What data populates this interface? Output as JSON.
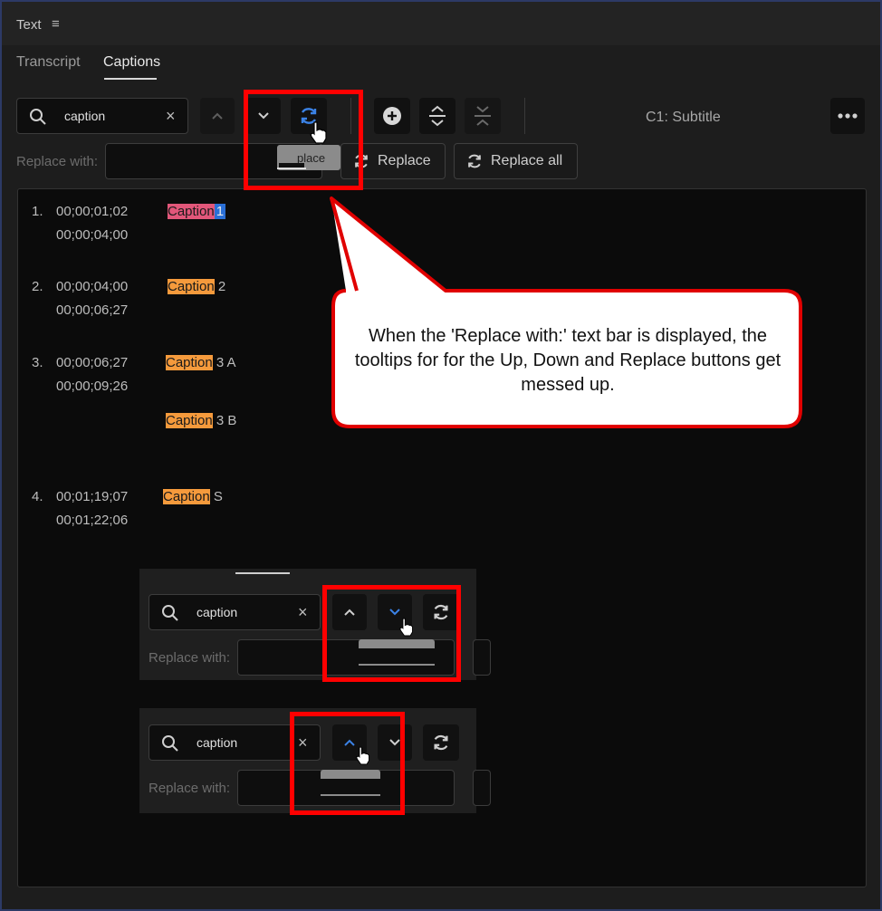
{
  "panel": {
    "title": "Text",
    "menu_icon": "hamburger-icon"
  },
  "tabs": [
    {
      "label": "Transcript",
      "active": false
    },
    {
      "label": "Captions",
      "active": true
    }
  ],
  "search": {
    "value": "caption",
    "clear_glyph": "×"
  },
  "track_label": "C1: Subtitle",
  "replace": {
    "label": "Replace with:",
    "tooltip_fragment": "place",
    "replace_label": "Replace",
    "replace_all_label": "Replace all"
  },
  "captions": [
    {
      "number": "1.",
      "start": "00;00;01;02",
      "end": "00;00;04;00",
      "lines": [
        {
          "match": "Caption",
          "rest": "1"
        }
      ]
    },
    {
      "number": "2.",
      "start": "00;00;04;00",
      "end": "00;00;06;27",
      "lines": [
        {
          "match": "Caption",
          "rest": "2"
        }
      ]
    },
    {
      "number": "3.",
      "start": "00;00;06;27",
      "end": "00;00;09;26",
      "lines": [
        {
          "match": "Caption",
          "rest": "3 A"
        },
        {
          "match": "Caption",
          "rest": "3 B"
        }
      ]
    },
    {
      "number": "4.",
      "start": "00;01;19;07",
      "end": "00;01;22;06",
      "lines": [
        {
          "match": "Caption",
          "rest": "S"
        }
      ]
    }
  ],
  "insets": [
    {
      "search_value": "caption",
      "replace_label": "Replace with:",
      "clear_glyph": "×"
    },
    {
      "search_value": "caption",
      "replace_label": "Replace with:",
      "clear_glyph": "×"
    }
  ],
  "callout": {
    "text": "When the 'Replace with:' text bar is displayed, the tooltips for for the Up, Down and Replace buttons get messed up."
  },
  "colors": {
    "match_highlight": "#f59a3c",
    "current_match": "#e2577a",
    "annotation_red": "#ff0000",
    "active_icon_blue": "#3b82e6"
  }
}
